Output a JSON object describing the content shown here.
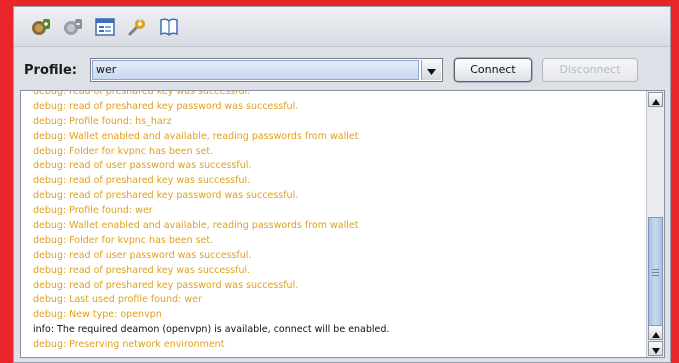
{
  "toolbar": {
    "buttons": [
      {
        "icon": "connect-icon"
      },
      {
        "icon": "disconnect-icon"
      },
      {
        "icon": "profile-manager-icon"
      },
      {
        "icon": "settings-wrench-icon"
      },
      {
        "icon": "log-book-icon"
      }
    ]
  },
  "profile": {
    "label": "Profile:",
    "selected": "wer"
  },
  "buttons": {
    "connect": "Connect",
    "disconnect": "Disconnect"
  },
  "colors": {
    "debug_text": "#e0a01c",
    "info_text": "#111111",
    "background": "#e8262a"
  },
  "log": {
    "lines": [
      {
        "text": "debug: read of preshared key was successful.",
        "level": "debug"
      },
      {
        "text": "debug: read of preshared key password was successful.",
        "level": "debug"
      },
      {
        "text": "debug: Profile found: hs_harz",
        "level": "debug"
      },
      {
        "text": "debug: Wallet enabled and available, reading passwords from wallet",
        "level": "debug"
      },
      {
        "text": "debug: Folder for kvpnc has been set.",
        "level": "debug"
      },
      {
        "text": "debug: read of user password was successful.",
        "level": "debug"
      },
      {
        "text": "debug: read of preshared key was successful.",
        "level": "debug"
      },
      {
        "text": "debug: read of preshared key password was successful.",
        "level": "debug"
      },
      {
        "text": "debug: Profile found: wer",
        "level": "debug"
      },
      {
        "text": "debug: Wallet enabled and available, reading passwords from wallet",
        "level": "debug"
      },
      {
        "text": "debug: Folder for kvpnc has been set.",
        "level": "debug"
      },
      {
        "text": "debug: read of user password was successful.",
        "level": "debug"
      },
      {
        "text": "debug: read of preshared key was successful.",
        "level": "debug"
      },
      {
        "text": "debug: read of preshared key password was successful.",
        "level": "debug"
      },
      {
        "text": "debug: Last used profile found: wer",
        "level": "debug"
      },
      {
        "text": "debug: New type: openvpn",
        "level": "debug"
      },
      {
        "text": "info: The required deamon (openvpn) is available, connect will be enabled.",
        "level": "info"
      },
      {
        "text": "debug: Preserving network environment",
        "level": "debug"
      }
    ]
  }
}
